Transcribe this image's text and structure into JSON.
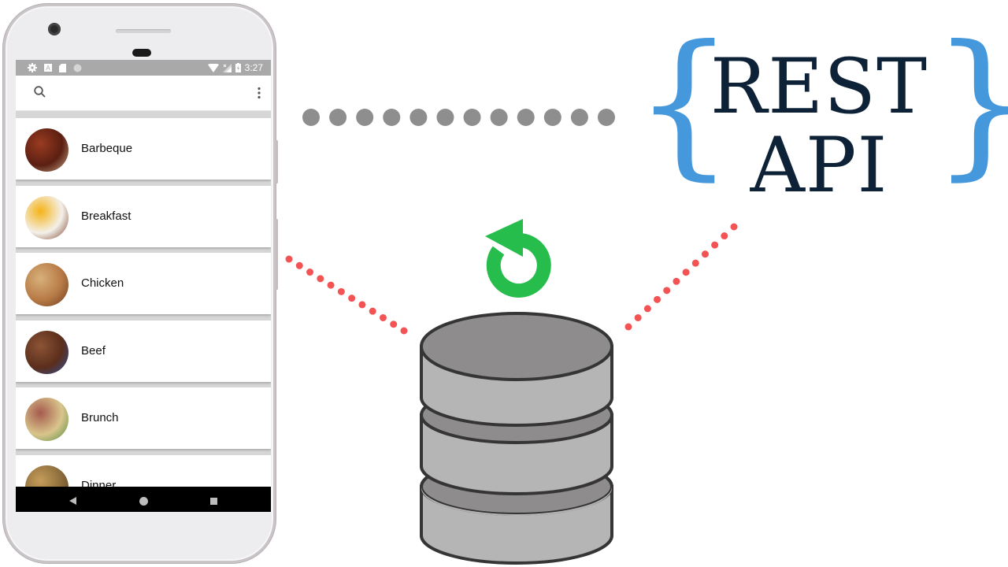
{
  "phone": {
    "status_bar": {
      "left_icons": [
        "settings-icon",
        "text-a-icon",
        "sd-card-icon",
        "circle-icon"
      ],
      "right_icons": [
        "wifi-icon",
        "signal-icon",
        "battery-charging-icon"
      ],
      "time": "3:27"
    },
    "app_bar": {
      "search_icon": "search-icon",
      "menu_icon": "more-vert-icon"
    },
    "categories": [
      {
        "label": "Barbeque",
        "colors": [
          "#5a1f12",
          "#9a3b20",
          "#c9a98a"
        ]
      },
      {
        "label": "Breakfast",
        "colors": [
          "#f3f0ea",
          "#f5b316",
          "#7a3f24"
        ]
      },
      {
        "label": "Chicken",
        "colors": [
          "#b77a46",
          "#d8b07a",
          "#6a3a1e"
        ]
      },
      {
        "label": "Beef",
        "colors": [
          "#5b2e1c",
          "#8c5435",
          "#2f4f9a"
        ]
      },
      {
        "label": "Brunch",
        "colors": [
          "#d9c58c",
          "#a55a4e",
          "#4d8b3f"
        ]
      },
      {
        "label": "Dinner",
        "colors": [
          "#8a6b3b",
          "#c69d5a",
          "#4a3a24"
        ]
      }
    ],
    "nav_bar": [
      "back-icon",
      "home-icon",
      "recents-icon"
    ]
  },
  "diagram": {
    "logo": {
      "open_brace": "{",
      "close_brace": "}",
      "line1": "REST",
      "line2": "API",
      "brace_color": "#4598dc",
      "text_color": "#0d2237"
    },
    "connector_color_api": "#8f8e8f",
    "connector_color_db": "#f45354",
    "sync_icon": "refresh-icon",
    "sync_color": "#27bd4c",
    "database_icon": "database-icon",
    "db_colors": {
      "top": "#8e8c8d",
      "body": "#b5b5b5",
      "stroke": "#353535"
    }
  }
}
